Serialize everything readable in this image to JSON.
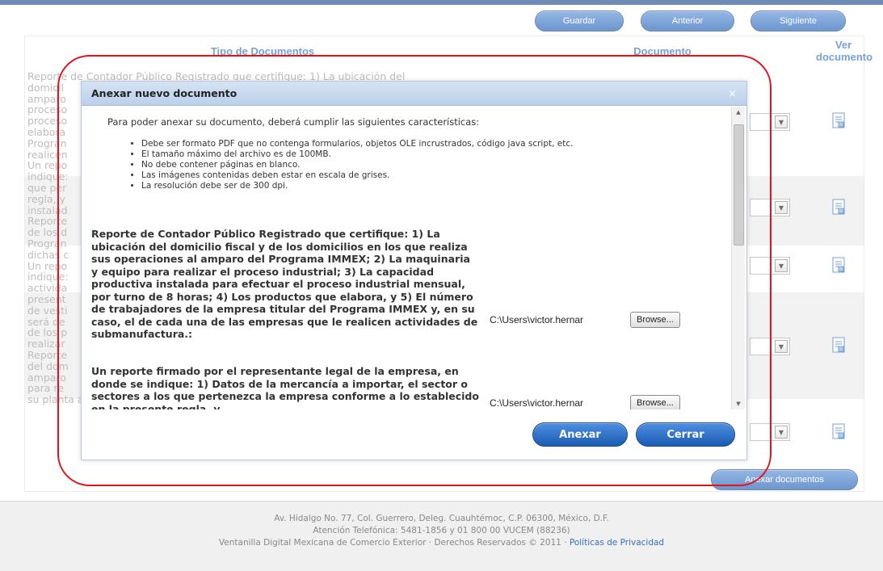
{
  "toolbar": {
    "save": "Guardar",
    "previous": "Anterior",
    "next": "Siguiente"
  },
  "table": {
    "col_type": "Tipo de Documentos",
    "col_document": "Documento",
    "col_view": "Ver documento",
    "background_text": "Reporte de Contador Público Registrado que certifique: 1) La ubicación del\ndomicil\namparo\nproceso\nproceso\nelabora\nProgran\nrealicen\nUn repo\nindique:\nque per\nregla, y\ninstalad\nReporte\nde los d\nProgran\ndichas c\nUn repo\nindique:\nactivida\npresent\nde vesti\nserá de\nde los p\nrealizar\nReporte\ndel dom\namparo\npara re\nsu planta a cabo. Esta actividad en la franja y región fronteriza norte."
  },
  "attach_documents_button": "Anexar documentos",
  "dialog": {
    "title": "Anexar nuevo documento",
    "close": "×",
    "intro": "Para poder anexar su documento, deberá cumplir las siguientes características:",
    "requirements": [
      "Debe ser formato PDF que no contenga formularios, objetos OLE incrustrados, código java script, etc.",
      "El tamaño máximo del archivo es de 100MB.",
      "No debe contener páginas en blanco.",
      "Las imágenes contenidas deben estar en escala de grises.",
      "La resolución debe ser de 300 dpi."
    ],
    "documents": [
      {
        "description": "Reporte de Contador Público Registrado que certifique: 1) La ubicación del domicilio fiscal y de los domicilios en los que realiza sus operaciones al amparo del Programa IMMEX; 2) La maquinaria y equipo para realizar el proceso industrial; 3) La capacidad productiva instalada para efectuar el proceso industrial mensual, por turno de 8 horas; 4) Los productos que elabora, y 5) El número de trabajadores de la empresa titular del Programa IMMEX y, en su caso, el de cada una de las empresas que le realicen actividades de submanufactura.:",
        "file_path": "C:\\Users\\victor.hernar",
        "browse": "Browse..."
      },
      {
        "description": "Un reporte firmado por el representante legal de la empresa, en donde se indique: 1) Datos de la mercancía a importar, el sector o sectores a los que pertenezca la empresa conforme a lo establecido en la presente regla, y",
        "file_path": "C:\\Users\\victor.hernar",
        "browse": "Browse..."
      }
    ],
    "attach_button": "Anexar",
    "close_button": "Cerrar"
  },
  "footer": {
    "address": "Av. Hidalgo No. 77, Col. Guerrero, Deleg. Cuauhtémoc, C.P. 06300, México, D.F.",
    "phone": "Atención Telefónica: 5481-1856 y 01 800 00 VUCEM (88236)",
    "rights": "Ventanilla Digital Mexicana de Comercio Exterior · Derechos Reservados © 2011 · ",
    "privacy_link": "Políticas de Privacidad"
  },
  "colors": {
    "accent": "#1f5fb5",
    "highlight": "#e0141c"
  }
}
